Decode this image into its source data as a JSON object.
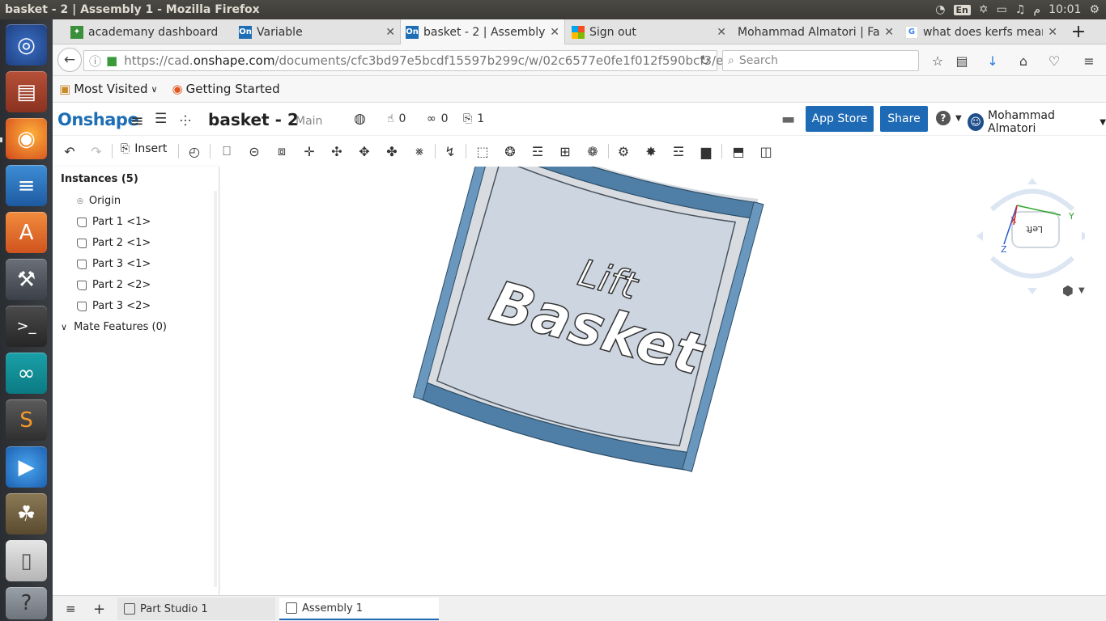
{
  "system": {
    "window_title": "basket - 2 | Assembly 1 - Mozilla Firefox",
    "keyboard_layout": "En",
    "time": "10:01",
    "time_suffix": "م"
  },
  "launcher": {
    "items": [
      "ubuntu-dash-icon",
      "files-icon",
      "firefox-icon",
      "libreoffice-writer-icon",
      "software-center-icon",
      "system-settings-icon",
      "terminal-icon",
      "arduino-icon",
      "sublime-text-icon",
      "media-player-icon",
      "gimp-icon",
      "mouse-settings-icon"
    ]
  },
  "tabs": [
    {
      "label": "academany dashboard",
      "favicon": "academany-icon"
    },
    {
      "label": "Variable",
      "favicon": "onshape-icon"
    },
    {
      "label": "basket - 2 | Assembly 1",
      "favicon": "onshape-icon",
      "active": true
    },
    {
      "label": "Sign out",
      "favicon": "microsoft-icon"
    },
    {
      "label": "Mohammad Almatori | Fa",
      "favicon": "none"
    },
    {
      "label": "what does kerfs mean",
      "favicon": "google-icon"
    }
  ],
  "newtab_label": "+",
  "navbar": {
    "url_prefix": "https://cad.",
    "url_domain": "onshape.com",
    "url_path": "/documents/cfc3bd97e5bcdf15597b299c/w/02c6577e0fe1f012f590bcf3/e/",
    "search_placeholder": "Search"
  },
  "bookmarks": {
    "most_visited": "Most Visited",
    "getting_started": "Getting Started"
  },
  "onshape": {
    "logo": "Onshape",
    "document_name": "basket - 2",
    "branch": "Main",
    "likes": "0",
    "links": "0",
    "copies": "1",
    "app_store": "App Store",
    "share": "Share",
    "help": "?",
    "user_name": "Mohammad Almatori"
  },
  "toolbar": {
    "insert_label": "Insert"
  },
  "instances_panel": {
    "title": "Instances (5)",
    "items": [
      "Origin",
      "Part 1 <1>",
      "Part 2 <1>",
      "Part 3 <1>",
      "Part 2 <2>",
      "Part 3 <2>"
    ],
    "mate_features": "Mate Features (0)"
  },
  "model": {
    "text_line1": "Lift",
    "text_line2": "Basket",
    "frame_color": "#4a7aa0",
    "panel_color": "#c7d2de"
  },
  "view_cube": {
    "face_label": "Left",
    "axis_x": "X",
    "axis_y": "Y",
    "axis_z": "Z"
  },
  "bottom_tabs": [
    {
      "label": "Part Studio 1"
    },
    {
      "label": "Assembly 1",
      "active": true
    }
  ],
  "colors": {
    "accent": "#1e6ab5",
    "brand": "#1d6eb5"
  }
}
